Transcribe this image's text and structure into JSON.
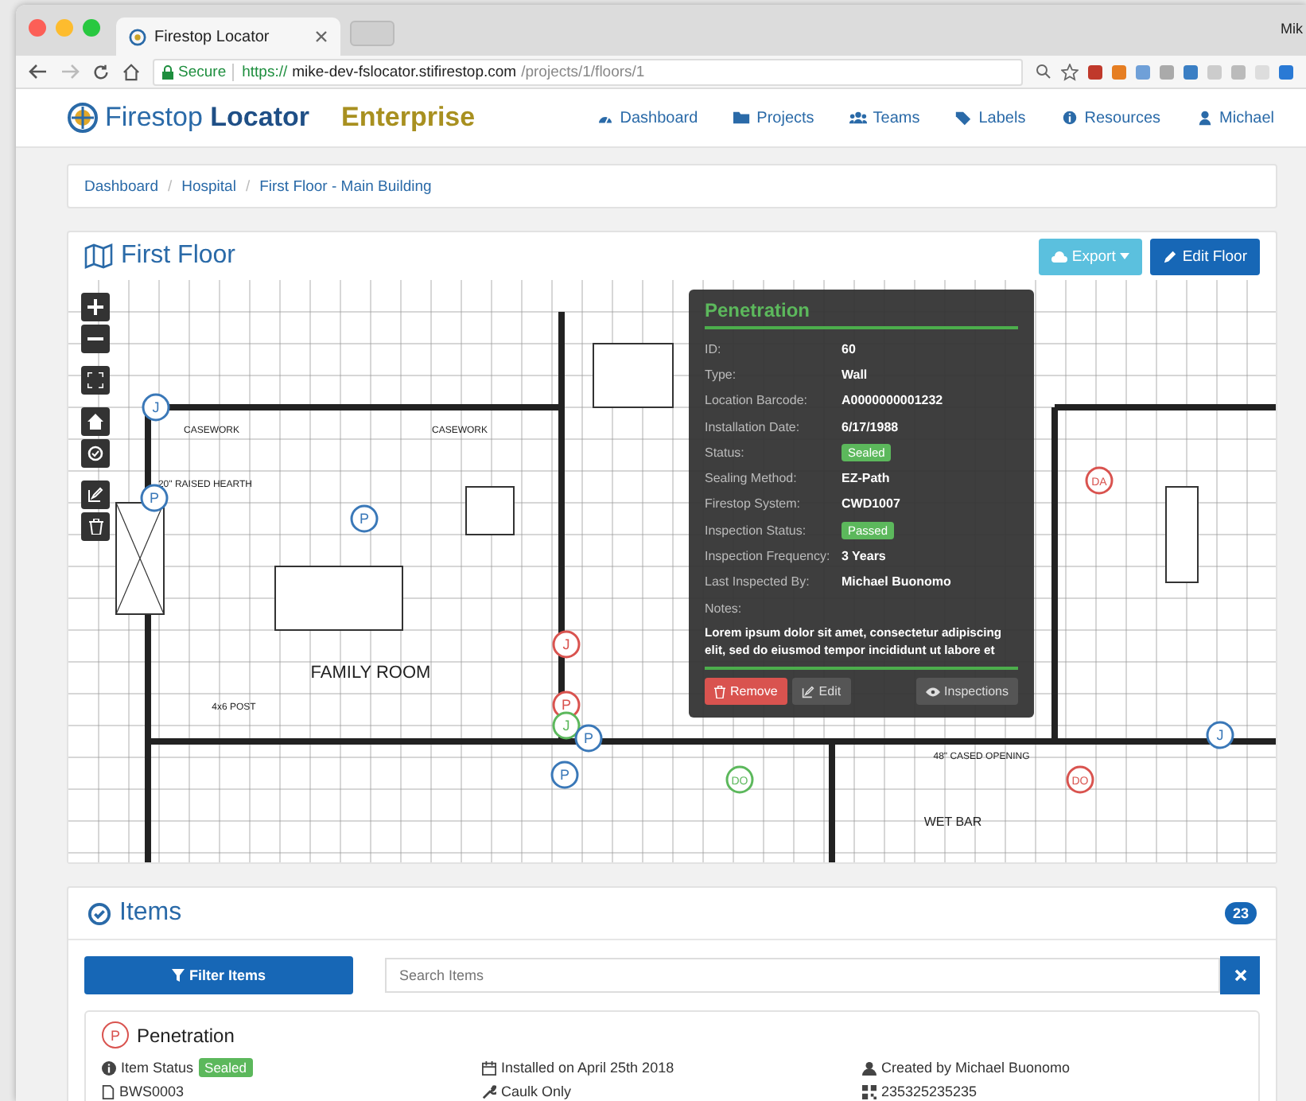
{
  "browser": {
    "tab_title": "Firestop Locator",
    "profile": "Mik",
    "secure": "Secure",
    "scheme": "https://",
    "host": "mike-dev-fslocator.stifirestop.com",
    "path": "/projects/1/floors/1"
  },
  "navbar": {
    "logo_light": "Firestop",
    "logo_bold": "Locator",
    "edition": "Enterprise",
    "links": [
      "Dashboard",
      "Projects",
      "Teams",
      "Labels",
      "Resources",
      "Michael"
    ]
  },
  "breadcrumb": {
    "separator": "/",
    "links": [
      "Dashboard",
      "Hospital",
      "First Floor - Main Building"
    ]
  },
  "floor": {
    "title": "First Floor",
    "export_button": "Export",
    "edit_button": "Edit Floor",
    "plan_labels": [
      "FAMILY ROOM",
      "CASEWORK",
      "CASEWORK",
      "WET BAR",
      "20\" RAISED HEARTH",
      "48\" CASED OPENING",
      "4x6 POST"
    ],
    "markers": [
      {
        "label": "J",
        "color": "#3a78b8"
      },
      {
        "label": "P",
        "color": "#3a78b8"
      },
      {
        "label": "P",
        "color": "#3a78b8"
      },
      {
        "label": "J",
        "color": "#d9534f"
      },
      {
        "label": "P",
        "color": "#d9534f"
      },
      {
        "label": "J",
        "color": "#5cb85c"
      },
      {
        "label": "P",
        "color": "#3a78b8"
      },
      {
        "label": "P",
        "color": "#3a78b8"
      },
      {
        "label": "DO",
        "color": "#5cb85c"
      },
      {
        "label": "DO",
        "color": "#d9534f"
      },
      {
        "label": "DA",
        "color": "#d9534f"
      },
      {
        "label": "J",
        "color": "#3a78b8"
      }
    ]
  },
  "popup": {
    "title": "Penetration",
    "fields": [
      {
        "label": "ID:",
        "value": "60",
        "kind": "text"
      },
      {
        "label": "Type:",
        "value": "Wall",
        "kind": "text"
      },
      {
        "label": "Location Barcode:",
        "value": "A0000000001232",
        "kind": "text"
      },
      {
        "label": "Installation Date:",
        "value": "6/17/1988",
        "kind": "text"
      },
      {
        "label": "Status:",
        "value": "Sealed",
        "kind": "badge"
      },
      {
        "label": "Sealing Method:",
        "value": "EZ-Path",
        "kind": "text"
      },
      {
        "label": "Firestop System:",
        "value": "CWD1007",
        "kind": "text"
      },
      {
        "label": "Inspection Status:",
        "value": "Passed",
        "kind": "badge"
      },
      {
        "label": "Inspection Frequency:",
        "value": "3 Years",
        "kind": "text"
      },
      {
        "label": "Last Inspected By:",
        "value": "Michael Buonomo",
        "kind": "text"
      }
    ],
    "notes_label": "Notes:",
    "notes": "Lorem ipsum dolor sit amet, consectetur adipiscing elit, sed do eiusmod tempor incididunt ut labore et",
    "remove_button": "Remove",
    "edit_button": "Edit",
    "inspections_button": "Inspections"
  },
  "items": {
    "title": "Items",
    "count": "23",
    "filter_button": "Filter Items",
    "search": {
      "placeholder": "Search Items"
    },
    "list": [
      {
        "marker": "P",
        "title": "Penetration",
        "status_label": "Item Status",
        "status": "Sealed",
        "installed": "Installed on April 25th 2018",
        "created": "Created by Michael Buonomo",
        "barcode": "BWS0003",
        "method": "Caulk Only",
        "code": "235325235235"
      }
    ]
  }
}
